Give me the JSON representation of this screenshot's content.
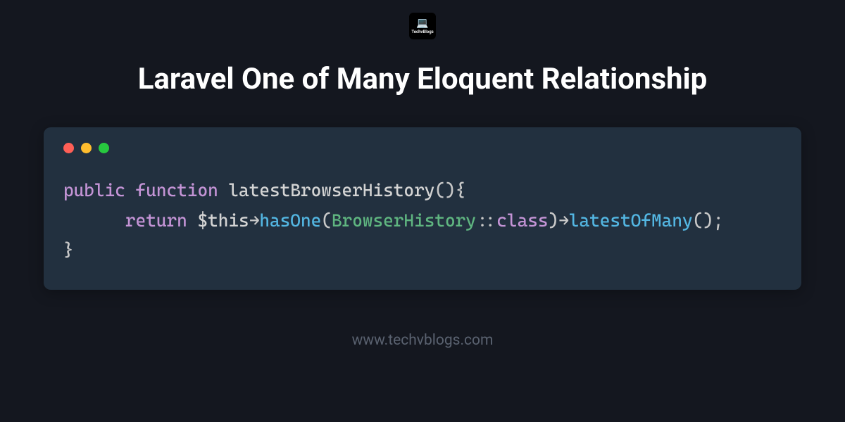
{
  "logo": {
    "icon": "💻",
    "text": "TechvBlogs"
  },
  "title": "Laravel One of Many Eloquent Relationship",
  "code": {
    "line1": {
      "public": "public",
      "function": "function",
      "funcName": "latestBrowserHistory",
      "parenOpen": "(",
      "parenClose": ")",
      "braceOpen": "{"
    },
    "line2": {
      "indent": "      ",
      "return": "return",
      "thisVar": "$this",
      "arrow1": "→",
      "hasOne": "hasOne",
      "parenOpen1": "(",
      "browserHistory": "BrowserHistory",
      "doubleColon": "::",
      "classKw": "class",
      "parenClose1": ")",
      "arrow2": "→",
      "latestOfMany": "latestOfMany",
      "parenOpen2": "(",
      "parenClose2": ")",
      "semicolon": ";"
    },
    "line3": {
      "braceClose": "}"
    }
  },
  "footer": "www.techvblogs.com"
}
